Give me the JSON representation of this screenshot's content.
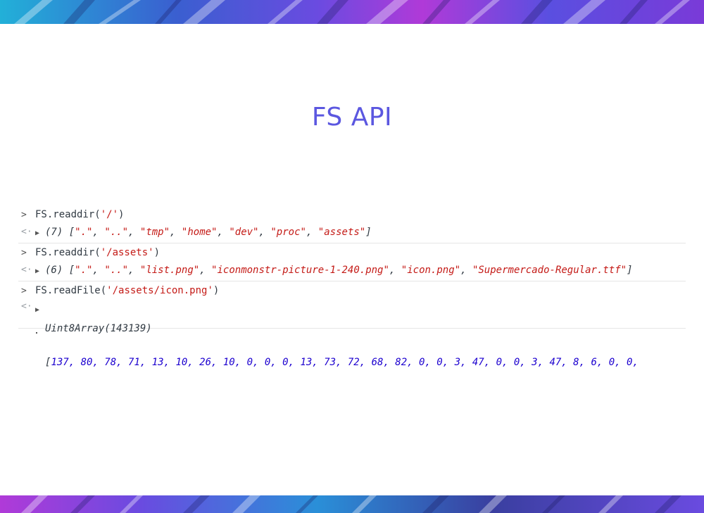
{
  "slide": {
    "title": "FS API"
  },
  "console": {
    "entries": [
      {
        "kind": "input",
        "prompt": ">",
        "code_prefix": "FS.readdir(",
        "code_string": "'/'",
        "code_suffix": ")"
      },
      {
        "kind": "output",
        "prompt": "<·",
        "count": "(7)",
        "items": [
          "\".\"",
          "\"..\"",
          "\"tmp\"",
          "\"home\"",
          "\"dev\"",
          "\"proc\"",
          "\"assets\""
        ]
      },
      {
        "kind": "input",
        "prompt": ">",
        "code_prefix": "FS.readdir(",
        "code_string": "'/assets'",
        "code_suffix": ")"
      },
      {
        "kind": "output",
        "prompt": "<·",
        "count": "(6)",
        "items": [
          "\".\"",
          "\"..\"",
          "\"list.png\"",
          "\"iconmonstr-picture-1-240.png\"",
          "\"icon.png\"",
          "\"Supermercado-Regular.ttf\""
        ]
      },
      {
        "kind": "input",
        "prompt": ">",
        "code_prefix": "FS.readFile(",
        "code_string": "'/assets/icon.png'",
        "code_suffix": ")"
      },
      {
        "kind": "output",
        "prompt": "<·",
        "type_label": "Uint8Array(143139)",
        "values": "137, 80, 78, 71, 13, 10, 26, 10, 0, 0, 0, 13, 73, 72, 68, 82, 0, 0, 3, 47, 0, 0, 3, 47, 8, 6, 0, 0,"
      }
    ]
  },
  "colors": {
    "title": "#5b57e0",
    "string": "#c41a16",
    "number": "#1c00cf",
    "code": "#303942"
  }
}
